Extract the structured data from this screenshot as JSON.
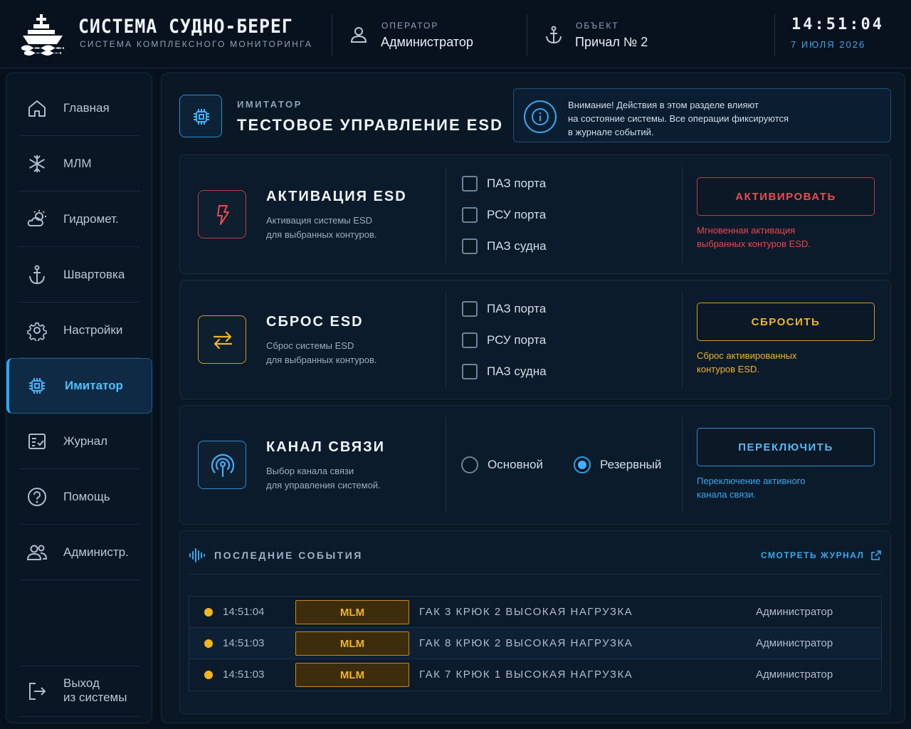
{
  "header": {
    "title": "СИСТЕМА СУДНО-БЕРЕГ",
    "subtitle": "СИСТЕМА КОМПЛЕКСНОГО МОНИТОРИНГА",
    "operator_label": "ОПЕРАТОР",
    "operator_value": "Администратор",
    "object_label": "ОБЪЕКТ",
    "object_value": "Причал № 2",
    "time": "14:51:04",
    "date": "7 ИЮЛЯ 2026"
  },
  "sidebar": {
    "items": [
      {
        "label": "Главная",
        "icon": "home-icon"
      },
      {
        "label": "МЛМ",
        "icon": "snowflake-icon"
      },
      {
        "label": "Гидромет.",
        "icon": "weather-icon"
      },
      {
        "label": "Швартовка",
        "icon": "anchor-icon"
      },
      {
        "label": "Настройки",
        "icon": "gear-icon"
      },
      {
        "label": "Имитатор",
        "icon": "chip-icon"
      },
      {
        "label": "Журнал",
        "icon": "journal-icon"
      },
      {
        "label": "Помощь",
        "icon": "help-icon"
      },
      {
        "label": "Администр.",
        "icon": "users-icon"
      }
    ],
    "active": "Имитатор",
    "logout_line1": "Выход",
    "logout_line2": "из системы"
  },
  "page": {
    "kicker": "ИМИТАТОР",
    "title": "ТЕСТОВОЕ УПРАВЛЕНИЕ ESD",
    "notice_line1": "Внимание! Действия в этом разделе влияют",
    "notice_line2": "на состояние системы. Все операции фиксируются",
    "notice_line3": "в журнале событий."
  },
  "cards": {
    "activate": {
      "title": "АКТИВАЦИЯ ESD",
      "desc_line1": "Активация системы ESD",
      "desc_line2": "для выбранных контуров.",
      "options": [
        "ПАЗ порта",
        "РСУ порта",
        "ПАЗ судна"
      ],
      "button": "АКТИВИРОВАТЬ",
      "note_line1": "Мгновенная активация",
      "note_line2": "выбранных контуров ESD.",
      "color": "#e8474c"
    },
    "reset": {
      "title": "СБРОС ESD",
      "desc_line1": "Сброс системы ESD",
      "desc_line2": "для выбранных контуров.",
      "options": [
        "ПАЗ порта",
        "РСУ порта",
        "ПАЗ судна"
      ],
      "button": "СБРОСИТЬ",
      "note_line1": "Сброс активированных",
      "note_line2": "контуров ESD.",
      "color": "#f0b429"
    },
    "channel": {
      "title": "КАНАЛ СВЯЗИ",
      "desc_line1": "Выбор канала связи",
      "desc_line2": "для управления системой.",
      "options": [
        "Основной",
        "Резервный"
      ],
      "selected": "Резервный",
      "button": "ПЕРЕКЛЮЧИТЬ",
      "note_line1": "Переключение активного",
      "note_line2": "канала связи.",
      "color": "#3aa7ee"
    }
  },
  "events": {
    "title": "ПОСЛЕДНИЕ СОБЫТИЯ",
    "link": "СМОТРЕТЬ ЖУРНАЛ",
    "rows": [
      {
        "time": "14:51:04",
        "tag": "MLM",
        "message": "ГАК 3 КРЮК 2 ВЫСОКАЯ НАГРУЗКА",
        "user": "Администратор"
      },
      {
        "time": "14:51:03",
        "tag": "MLM",
        "message": "ГАК 8 КРЮК 2 ВЫСОКАЯ НАГРУЗКА",
        "user": "Администратор"
      },
      {
        "time": "14:51:03",
        "tag": "MLM",
        "message": "ГАК 7 КРЮК 1 ВЫСОКАЯ НАГРУЗКА",
        "user": "Администратор"
      }
    ]
  }
}
